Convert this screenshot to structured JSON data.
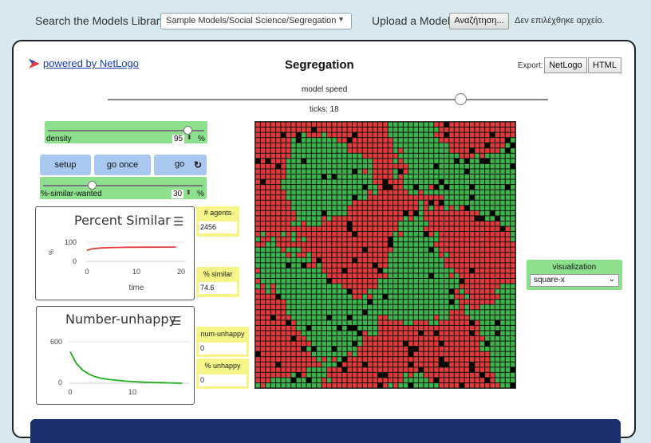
{
  "topbar": {
    "library_label": "Search the Models Library:",
    "library_value": "Sample Models/Social Science/Segregation",
    "upload_label": "Upload a Model:",
    "upload_button": "Αναζήτηση...",
    "upload_status": "Δεν επιλέχθηκε αρχείο."
  },
  "header": {
    "powered_by": "powered by NetLogo",
    "title": "Segregation",
    "export_label": "Export:",
    "export_netlogo": "NetLogo",
    "export_html": "HTML"
  },
  "speed": {
    "label": "model speed",
    "value": 0.8
  },
  "ticks_label": "ticks: 18",
  "density": {
    "name": "density",
    "value": "95",
    "unit": "%",
    "fraction": 0.9
  },
  "buttons": {
    "setup": "setup",
    "go_once": "go once",
    "go": "go",
    "go_icon": "forever-icon"
  },
  "similar_wanted": {
    "name": "%-similar-wanted",
    "value": "30",
    "unit": "%",
    "fraction": 0.3
  },
  "plot_similar": {
    "title": "Percent Similar",
    "menu_icon": "hamburger-icon",
    "ylabel": "%",
    "xlabel": "time",
    "ytick_max": "100",
    "ytick_min": "0",
    "xticks": [
      "0",
      "10",
      "20"
    ],
    "color": "#e53a3a",
    "chart_data": {
      "type": "line",
      "x": [
        0,
        1,
        2,
        3,
        4,
        5,
        6,
        7,
        8,
        9,
        10,
        11,
        12,
        13,
        14,
        15,
        16,
        17,
        18
      ],
      "y": [
        58,
        65,
        68,
        70,
        71,
        72,
        72.5,
        73,
        73.3,
        73.6,
        73.8,
        74,
        74.1,
        74.2,
        74.3,
        74.4,
        74.5,
        74.5,
        74.6
      ],
      "xlim": [
        0,
        20
      ],
      "ylim": [
        0,
        100
      ]
    }
  },
  "plot_unhappy": {
    "title": "Number-unhappy",
    "menu_icon": "hamburger-icon",
    "ytick_max": "600",
    "ytick_min": "0",
    "xticks": [
      "0",
      "10"
    ],
    "color": "#22b022",
    "chart_data": {
      "type": "line",
      "x": [
        0,
        1,
        2,
        3,
        4,
        5,
        6,
        7,
        8,
        9,
        10,
        11,
        12,
        13,
        14,
        15,
        16,
        17,
        18
      ],
      "y": [
        480,
        300,
        200,
        140,
        100,
        75,
        60,
        50,
        40,
        32,
        26,
        20,
        16,
        12,
        10,
        8,
        5,
        3,
        0
      ],
      "xlim": [
        0,
        20
      ],
      "ylim": [
        0,
        800
      ]
    }
  },
  "monitors": {
    "agents": {
      "label": "# agents",
      "value": "2456"
    },
    "similar": {
      "label": "% similar",
      "value": "74.6"
    },
    "num_unhappy": {
      "label": "num-unhappy",
      "value": "0"
    },
    "pct_unhappy": {
      "label": "% unhappy",
      "value": "0"
    }
  },
  "visualization": {
    "label": "visualization",
    "value": "square-x"
  },
  "world": {
    "colors": {
      "red": "#e03a3a",
      "green": "#3cb44a",
      "empty": "#000000"
    },
    "cols": 51,
    "rows": 51
  }
}
